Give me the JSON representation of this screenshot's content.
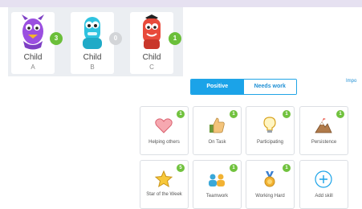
{
  "students": [
    {
      "first": "Child",
      "last": "A",
      "points": "3",
      "badge_color": "#6bbf3a"
    },
    {
      "first": "Child",
      "last": "B",
      "points": "0",
      "badge_color": "#d3d5d8"
    },
    {
      "first": "Child",
      "last": "C",
      "points": "1",
      "badge_color": "#6bbf3a"
    }
  ],
  "toggle": {
    "positive": "Positive",
    "needs_work": "Needs work"
  },
  "imp_link": "Impo",
  "skills": [
    {
      "label": "Helping others",
      "count": "1",
      "icon": "heart-icon"
    },
    {
      "label": "On Task",
      "count": "1",
      "icon": "thumbs-up-icon"
    },
    {
      "label": "Participating",
      "count": "1",
      "icon": "lightbulb-icon"
    },
    {
      "label": "Persistence",
      "count": "1",
      "icon": "mountain-icon"
    },
    {
      "label": "Star of the Week",
      "count": "5",
      "icon": "star-icon"
    },
    {
      "label": "Teamwork",
      "count": "1",
      "icon": "teamwork-icon"
    },
    {
      "label": "Working Hard",
      "count": "1",
      "icon": "medal-icon"
    },
    {
      "label": "Add skill",
      "count": "",
      "icon": "plus-circle-icon"
    }
  ],
  "colors": {
    "accent": "#1ba3e8",
    "badge_green": "#71c23e",
    "panel_bg": "#ebeef2"
  }
}
